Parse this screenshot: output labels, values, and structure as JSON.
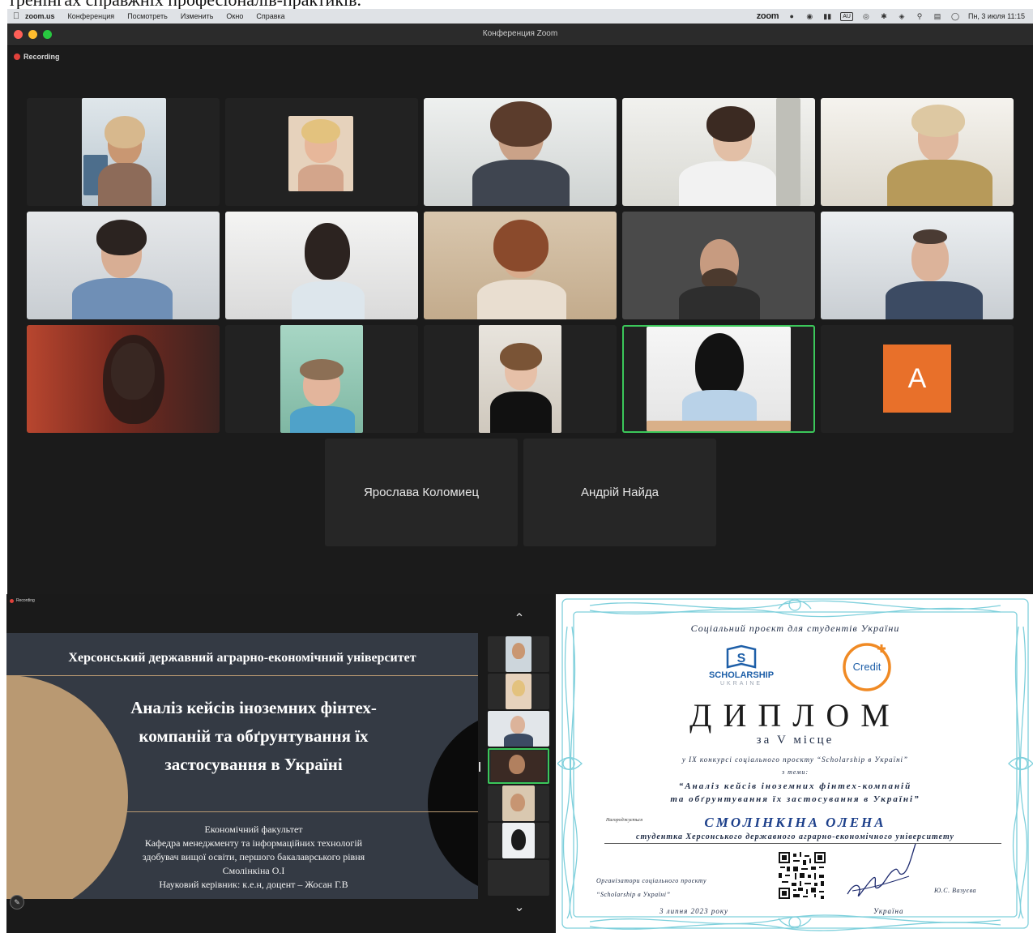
{
  "document": {
    "caption_partial": "тренінгах справжніх професіоналів-практиків."
  },
  "zoom": {
    "menubar": {
      "app": "zoom.us",
      "items": [
        "Конференция",
        "Посмотреть",
        "Изменить",
        "Окно",
        "Справка"
      ],
      "tray_zoom": "zoom",
      "tray_au": "AU",
      "clock": "Пн, 3 июля  11:15"
    },
    "window_title": "Конференция Zoom",
    "recording_label": "Recording",
    "avatar_letter": "A",
    "participants_names": [
      "Ярослава Коломиец",
      "Андрій Найда"
    ],
    "colors": {
      "active_speaker": "#3bc75a",
      "avatar_bg": "#e8702a",
      "recording": "#e0413b"
    }
  },
  "presentation": {
    "recording_label": "Recording",
    "university": "Херсонський державний аграрно-економічний університет",
    "topic": "Аналіз кейсів іноземних фінтех-компаній та обґрунтування їх застосування в Україні",
    "info_lines": [
      "Економічний факультет",
      "Кафедра менеджменту та інформаційних технологій",
      "здобувач вищої освіти, першого бакалаврського рівня",
      "Смолінкіна О.І",
      "Науковий керівник: к.е.н, доцент – Жосан Г.В"
    ],
    "colors": {
      "slide_bg": "#343a44",
      "accent": "#b99972"
    }
  },
  "diploma": {
    "subtitle": "Соціальний проєкт для студентів України",
    "logo_scholarship": "SCHOLARSHIP",
    "logo_scholarship_sub": "UKRAINE",
    "logo_credit": "Credit",
    "title": "ДИПЛОМ",
    "place": "за V місце",
    "contest": "у IX конкурсі соціального проєкту “Scholarship в Україні”",
    "topic_label": "з теми:",
    "topic_line1": "“Аналіз кейсів іноземних фінтех-компаній",
    "topic_line2": "та обґрунтування їх застосування в Україні”",
    "awarded_label": "Нагороджується",
    "name": "СМОЛІНКІНА ОЛЕНА",
    "student_line": "студентка Херсонського державного аграрно-економічного університету",
    "organizers_line1": "Організатори соціального проєкту",
    "organizers_line2": "“Scholarship в Україні”",
    "signer": "Ю.С. Вазуєва",
    "date": "3 липня 2023 року",
    "country": "Україна",
    "colors": {
      "frame": "#7fd0dc",
      "title_blue": "#1c3f8a",
      "credit_orange": "#f08a24"
    }
  }
}
